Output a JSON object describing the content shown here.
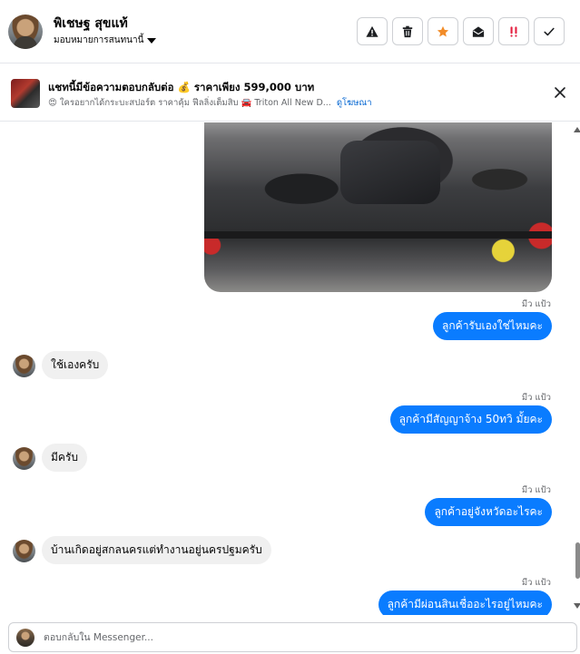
{
  "header": {
    "contact_name": "พิเชษฐ สุขแท้",
    "assign_label": "มอบหมายการสนทนานี้",
    "actions": [
      {
        "name": "report-button",
        "icon": "warning-icon"
      },
      {
        "name": "delete-button",
        "icon": "trash-icon"
      },
      {
        "name": "star-button",
        "icon": "star-icon"
      },
      {
        "name": "mark-unread-button",
        "icon": "envelope-open-icon"
      },
      {
        "name": "spam-button",
        "icon": "exclamation-icon"
      },
      {
        "name": "done-button",
        "icon": "check-icon"
      }
    ]
  },
  "ad": {
    "title": "แชทนี้มีข้อความตอบกลับต่อ 💰 ราคาเพียง 599,000 บาท",
    "subtitle": "😍 ใครอยากได้กระบะสปอร์ต ราคาคุ้ม ฟีลลิ่งเต็มสิบ 🚘 Triton All New D...",
    "link": "ดูโฆษณา"
  },
  "messages": {
    "m1": {
      "seen": "มีว แป้ว",
      "text": "ลูกค้ารับเองใช่ไหมคะ"
    },
    "m2": {
      "text": "ใช้เองครับ"
    },
    "m3": {
      "seen": "มีว แป้ว",
      "text": "ลูกค้ามีสัญญาจ้าง   50ทวิ  มั้ยคะ"
    },
    "m4": {
      "text": "มีครับ"
    },
    "m5": {
      "seen": "มีว แป้ว",
      "text": "ลูกค้าอยู่จังหวัดอะไรคะ"
    },
    "m6": {
      "text": "บ้านเกิดอยู่สกลนครแต่ทำงานอยู่นครปฐมครับ"
    },
    "m7": {
      "seen": "มีว แป้ว",
      "text": "ลูกค้ามีผ่อนสินเชื่ออะไรอยู่ไหมคะ"
    }
  },
  "composer": {
    "placeholder": "ตอบกลับใน Messenger..."
  },
  "colors": {
    "outgoing_bubble": "#0a7cff",
    "incoming_bubble": "#f0f0f0",
    "star": "#f28c28",
    "spam": "#e41e3f"
  }
}
